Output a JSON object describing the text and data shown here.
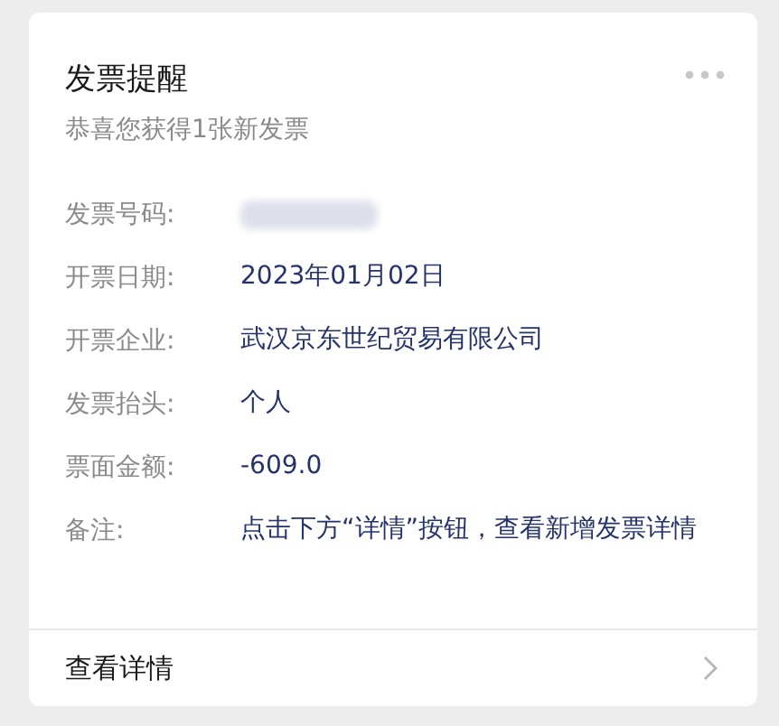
{
  "card": {
    "title": "发票提醒",
    "subtitle": "恭喜您获得1张新发票",
    "fields": [
      {
        "label": "发票号码:",
        "redacted": true
      },
      {
        "label": "开票日期:",
        "value": "2023年01月02日"
      },
      {
        "label": "开票企业:",
        "value": "武汉京东世纪贸易有限公司"
      },
      {
        "label": "发票抬头:",
        "value": "个人"
      },
      {
        "label": "票面金额:",
        "value": "-609.0"
      },
      {
        "label": "备注:",
        "value": "点击下方“详情”按钮，查看新增发票详情"
      }
    ],
    "footer_link": "查看详情"
  }
}
